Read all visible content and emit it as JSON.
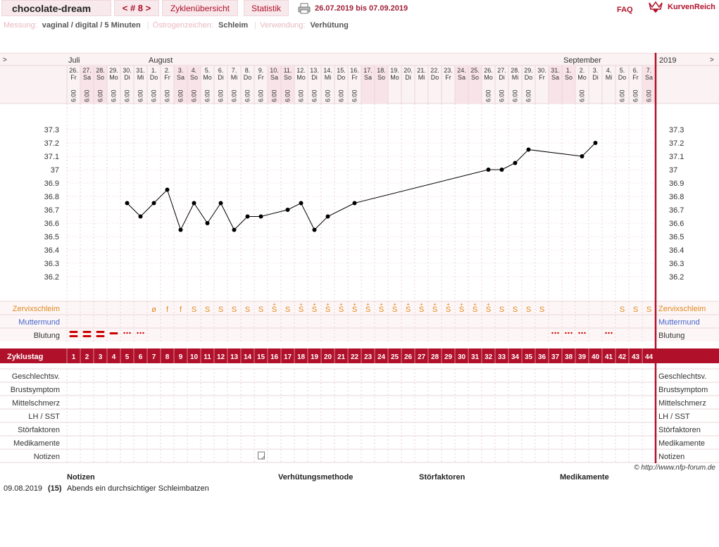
{
  "header": {
    "user_name": "chocolate-dream",
    "cycle_nav": "< # 8 >",
    "tab_overview": "Zyklenübersicht",
    "tab_stats": "Statistik",
    "date_range": "26.07.2019 bis 07.09.2019",
    "faq": "FAQ",
    "logo_text": "KurvenReich",
    "print_icon": "printer-icon",
    "logo_icon": "crown-heart-icon"
  },
  "settings": {
    "measure_label": "Messung:",
    "measure_value": "vaginal / digital / 5 Minuten",
    "estrogen_label": "Östrogenzeichen:",
    "estrogen_value": "Schleim",
    "use_label": "Verwendung:",
    "use_value": "Verhütung"
  },
  "colors": {
    "accent": "#b0102a",
    "weekend": "#f8e4e8",
    "grid": "#ead0d4",
    "mucus": "#e08a1e",
    "cervix": "#4466cc",
    "bleeding": "#cc0000"
  },
  "chart_data": {
    "type": "line",
    "year": "2019",
    "expand_marker": ">",
    "months": [
      {
        "label": "Juli",
        "day_index": 0
      },
      {
        "label": "August",
        "day_index": 6
      },
      {
        "label": "September",
        "day_index": 37
      }
    ],
    "days": [
      {
        "d": "26.",
        "w": "Fr",
        "t": "6:00",
        "we": false
      },
      {
        "d": "27.",
        "w": "Sa",
        "t": "6:00",
        "we": true
      },
      {
        "d": "28.",
        "w": "So",
        "t": "6:00",
        "we": true
      },
      {
        "d": "29.",
        "w": "Mo",
        "t": "6:00",
        "we": false
      },
      {
        "d": "30.",
        "w": "Di",
        "t": "6:00",
        "we": false
      },
      {
        "d": "31.",
        "w": "Mi",
        "t": "6:00",
        "we": false
      },
      {
        "d": "1.",
        "w": "Do",
        "t": "6:00",
        "we": false
      },
      {
        "d": "2.",
        "w": "Fr",
        "t": "6:00",
        "we": false
      },
      {
        "d": "3.",
        "w": "Sa",
        "t": "6:00",
        "we": true
      },
      {
        "d": "4.",
        "w": "So",
        "t": "6:00",
        "we": true
      },
      {
        "d": "5.",
        "w": "Mo",
        "t": "6:00",
        "we": false
      },
      {
        "d": "6.",
        "w": "Di",
        "t": "6:00",
        "we": false
      },
      {
        "d": "7.",
        "w": "Mi",
        "t": "6:00",
        "we": false
      },
      {
        "d": "8.",
        "w": "Do",
        "t": "6:00",
        "we": false
      },
      {
        "d": "9.",
        "w": "Fr",
        "t": "6:00",
        "we": false
      },
      {
        "d": "10.",
        "w": "Sa",
        "t": "6:00",
        "we": true
      },
      {
        "d": "11.",
        "w": "So",
        "t": "6:00",
        "we": true
      },
      {
        "d": "12.",
        "w": "Mo",
        "t": "6:00",
        "we": false
      },
      {
        "d": "13.",
        "w": "Di",
        "t": "6:00",
        "we": false
      },
      {
        "d": "14.",
        "w": "Mi",
        "t": "6:00",
        "we": false
      },
      {
        "d": "15.",
        "w": "Do",
        "t": "6:00",
        "we": false
      },
      {
        "d": "16.",
        "w": "Fr",
        "t": "6:00",
        "we": false
      },
      {
        "d": "17.",
        "w": "Sa",
        "t": "",
        "we": true
      },
      {
        "d": "18.",
        "w": "So",
        "t": "",
        "we": true
      },
      {
        "d": "19.",
        "w": "Mo",
        "t": "",
        "we": false
      },
      {
        "d": "20.",
        "w": "Di",
        "t": "",
        "we": false
      },
      {
        "d": "21.",
        "w": "Mi",
        "t": "",
        "we": false
      },
      {
        "d": "22.",
        "w": "Do",
        "t": "",
        "we": false
      },
      {
        "d": "23.",
        "w": "Fr",
        "t": "",
        "we": false
      },
      {
        "d": "24.",
        "w": "Sa",
        "t": "",
        "we": true
      },
      {
        "d": "25.",
        "w": "So",
        "t": "",
        "we": true
      },
      {
        "d": "26.",
        "w": "Mo",
        "t": "6:00",
        "we": false
      },
      {
        "d": "27.",
        "w": "Di",
        "t": "6:00",
        "we": false
      },
      {
        "d": "28.",
        "w": "Mi",
        "t": "6:00",
        "we": false
      },
      {
        "d": "29.",
        "w": "Do",
        "t": "6:00",
        "we": false
      },
      {
        "d": "30.",
        "w": "Fr",
        "t": "",
        "we": false
      },
      {
        "d": "31.",
        "w": "Sa",
        "t": "",
        "we": true
      },
      {
        "d": "1.",
        "w": "So",
        "t": "",
        "we": true
      },
      {
        "d": "2.",
        "w": "Mo",
        "t": "6:00",
        "we": false
      },
      {
        "d": "3.",
        "w": "Di",
        "t": "",
        "we": false
      },
      {
        "d": "4.",
        "w": "Mi",
        "t": "",
        "we": false
      },
      {
        "d": "5.",
        "w": "Do",
        "t": "6:00",
        "we": false
      },
      {
        "d": "6.",
        "w": "Fr",
        "t": "6:00",
        "we": false
      },
      {
        "d": "7.",
        "w": "Sa",
        "t": "6:00",
        "we": true
      }
    ],
    "y_ticks": [
      "37.3",
      "37.2",
      "37.1",
      "37",
      "36.9",
      "36.8",
      "36.7",
      "36.6",
      "36.5",
      "36.4",
      "36.3",
      "36.2"
    ],
    "ylim": [
      36.2,
      37.3
    ],
    "temperatures": [
      null,
      null,
      null,
      null,
      36.75,
      36.65,
      36.75,
      36.85,
      36.55,
      36.75,
      36.6,
      36.75,
      36.55,
      36.65,
      36.65,
      null,
      36.7,
      36.75,
      36.55,
      36.65,
      null,
      36.75,
      null,
      null,
      null,
      null,
      null,
      null,
      null,
      null,
      null,
      37.0,
      37.0,
      37.05,
      37.15,
      null,
      null,
      null,
      37.1,
      37.2,
      null,
      null,
      null,
      null
    ],
    "mucus_label": "Zervixschleim",
    "mucus": [
      "",
      "",
      "",
      "",
      "",
      "",
      "ø",
      "f",
      "f",
      "S",
      "S",
      "S",
      "S",
      "S",
      "S",
      "S+",
      "S",
      "S+",
      "S+",
      "S+",
      "S+",
      "S+",
      "S+",
      "S+",
      "S+",
      "S+",
      "S+",
      "S+",
      "S+",
      "S+",
      "S+",
      "S+",
      "S",
      "S",
      "S",
      "S",
      "",
      "",
      "",
      "",
      "",
      "S",
      "S",
      "S"
    ],
    "cervix_label": "Muttermund",
    "bleeding_label": "Blutung",
    "bleeding": [
      "H",
      "H",
      "H",
      "M",
      "L",
      "L",
      "",
      "",
      "",
      "",
      "",
      "",
      "",
      "",
      "",
      "",
      "",
      "",
      "",
      "",
      "",
      "",
      "",
      "",
      "",
      "",
      "",
      "",
      "",
      "",
      "",
      "",
      "",
      "",
      "",
      "",
      "L",
      "L",
      "L",
      "",
      "L",
      "",
      "",
      ""
    ],
    "cycle_day_label": "Zyklustag",
    "cycle_days": [
      "1",
      "2",
      "3",
      "4",
      "5",
      "6",
      "7",
      "8",
      "9",
      "10",
      "11",
      "12",
      "13",
      "14",
      "15",
      "16",
      "17",
      "18",
      "19",
      "20",
      "21",
      "22",
      "23",
      "24",
      "25",
      "26",
      "27",
      "28",
      "29",
      "30",
      "31",
      "32",
      "33",
      "34",
      "35",
      "36",
      "37",
      "38",
      "39",
      "40",
      "41",
      "42",
      "43",
      "44"
    ],
    "symptom_rows": [
      "Geschlechtsv.",
      "Brustsymptom",
      "Mittelschmerz",
      "LH / SST",
      "Störfaktoren",
      "Medikamente",
      "Notizen"
    ],
    "note_marker_day_index": 14
  },
  "notes": {
    "copyright": "© http://www.nfp-forum.de",
    "headers": {
      "notes": "Notizen",
      "method": "Verhütungsmethode",
      "disturbances": "Störfaktoren",
      "medication": "Medikamente"
    },
    "rows": [
      {
        "date": "09.08.2019",
        "cycle_day": "(15)",
        "text": "Abends ein durchsichtiger Schleimbatzen"
      }
    ]
  }
}
